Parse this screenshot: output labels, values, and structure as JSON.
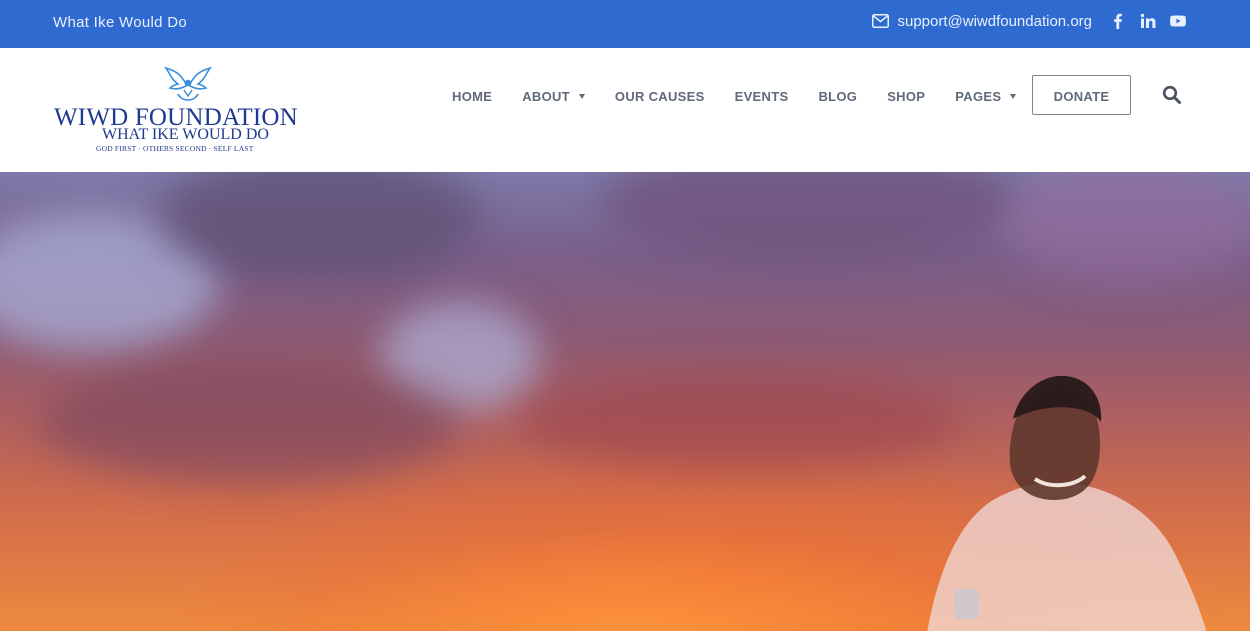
{
  "topbar": {
    "tagline": "What Ike Would Do",
    "email": "support@wiwdfoundation.org",
    "social_icons": [
      "facebook-icon",
      "linkedin-icon",
      "youtube-icon"
    ],
    "background_color": "#2f6ad0"
  },
  "logo": {
    "name": "WIWD FOUNDATION",
    "subtitle": "WHAT IKE WOULD DO",
    "motto": "GOD FIRST  ·  OTHERS SECOND  ·  SELF LAST",
    "color": "#1e3a8f"
  },
  "nav": {
    "items": [
      {
        "label": "HOME",
        "has_dropdown": false
      },
      {
        "label": "ABOUT",
        "has_dropdown": true
      },
      {
        "label": "OUR CAUSES",
        "has_dropdown": false
      },
      {
        "label": "EVENTS",
        "has_dropdown": false
      },
      {
        "label": "BLOG",
        "has_dropdown": false
      },
      {
        "label": "SHOP",
        "has_dropdown": false
      },
      {
        "label": "PAGES",
        "has_dropdown": true
      }
    ],
    "donate_label": "DONATE",
    "search_icon": "search-icon"
  },
  "hero": {
    "image": "sunset sky with portrait"
  }
}
